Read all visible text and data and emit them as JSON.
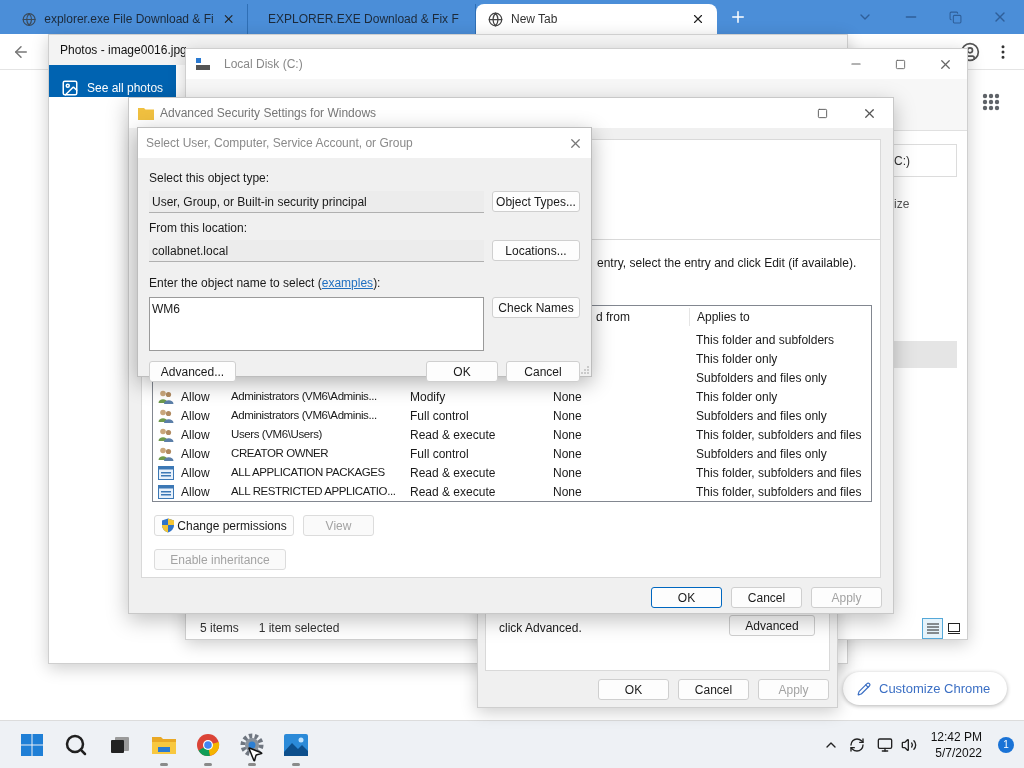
{
  "browser": {
    "tabs": [
      {
        "title": "explorer.exe File Download & Fi",
        "selected": false
      },
      {
        "title": "EXPLORER.EXE Download & Fix F",
        "selected": false
      },
      {
        "title": "New Tab",
        "selected": true
      }
    ],
    "customize": "Customize Chrome"
  },
  "photos": {
    "title": "Photos - image0016.jpg",
    "see_all": "See all photos"
  },
  "explorer": {
    "title": "Local Disk (C:)",
    "address": "C:)",
    "column_header": "ize",
    "item_count": "5 items",
    "selection": "1 item selected",
    "views": [
      {
        "kind": "details",
        "selected": true
      },
      {
        "kind": "thumbnails",
        "selected": false
      }
    ]
  },
  "properties": {
    "text": "click Advanced.",
    "advanced": "Advanced",
    "buttons": [
      {
        "label": "OK",
        "default": false,
        "disabled": false
      },
      {
        "label": "Cancel",
        "default": false,
        "disabled": false
      },
      {
        "label": "Apply",
        "default": false,
        "disabled": true
      }
    ]
  },
  "security": {
    "title": "Advanced Security Settings for Windows",
    "hint": "entry, select the entry and click Edit (if available).",
    "columns": [
      "d from",
      "Applies to"
    ],
    "rows": [
      {
        "applies": "This folder and subfolders"
      },
      {
        "applies": "This folder only"
      },
      {
        "applies": "Subfolders and files only"
      },
      {
        "kind": "group",
        "type": "Allow",
        "principal": "Administrators (VM6\\Adminis...",
        "access": "Modify",
        "inherited": "None",
        "applies": "This folder only"
      },
      {
        "kind": "group",
        "type": "Allow",
        "principal": "Administrators (VM6\\Adminis...",
        "access": "Full control",
        "inherited": "None",
        "applies": "Subfolders and files only"
      },
      {
        "kind": "group",
        "type": "Allow",
        "principal": "Users (VM6\\Users)",
        "access": "Read & execute",
        "inherited": "None",
        "applies": "This folder, subfolders and files"
      },
      {
        "kind": "group",
        "type": "Allow",
        "principal": "CREATOR OWNER",
        "access": "Full control",
        "inherited": "None",
        "applies": "Subfolders and files only"
      },
      {
        "kind": "package",
        "type": "Allow",
        "principal": "ALL APPLICATION PACKAGES",
        "access": "Read & execute",
        "inherited": "None",
        "applies": "This folder, subfolders and files"
      },
      {
        "kind": "package",
        "type": "Allow",
        "principal": "ALL RESTRICTED APPLICATIO...",
        "access": "Read & execute",
        "inherited": "None",
        "applies": "This folder, subfolders and files"
      }
    ],
    "actions": [
      {
        "label": "Change permissions",
        "disabled": false,
        "shield": true
      },
      {
        "label": "View",
        "disabled": true,
        "shield": false
      },
      {
        "label": "Enable inheritance",
        "disabled": true,
        "shield": false
      }
    ],
    "buttons": [
      {
        "label": "OK",
        "default": true,
        "disabled": false
      },
      {
        "label": "Cancel",
        "default": false,
        "disabled": false
      },
      {
        "label": "Apply",
        "default": false,
        "disabled": true
      }
    ]
  },
  "select_dialog": {
    "title": "Select User, Computer, Service Account, or Group",
    "type_label": "Select this object type:",
    "type_value": "User, Group, or Built-in security principal",
    "type_button": "Object Types...",
    "location_label": "From this location:",
    "location_value": "collabnet.local",
    "location_button": "Locations...",
    "name_label": {
      "before": "Enter the object name to select (",
      "link": "examples",
      "after": "):"
    },
    "name_value": "WM6",
    "check_button": "Check Names",
    "advanced_button": "Advanced...",
    "buttons": [
      {
        "label": "OK",
        "default": false,
        "disabled": false
      },
      {
        "label": "Cancel",
        "default": false,
        "disabled": false
      }
    ]
  },
  "taskbar": {
    "apps": [
      {
        "kind": "start",
        "running": false
      },
      {
        "kind": "search",
        "running": false
      },
      {
        "kind": "taskview",
        "running": false
      },
      {
        "kind": "explorer",
        "running": true
      },
      {
        "kind": "chrome",
        "running": true
      },
      {
        "kind": "settings",
        "running": true
      },
      {
        "kind": "photos",
        "running": true
      }
    ],
    "time": "12:42 PM",
    "date": "5/7/2022",
    "notifications": "1"
  }
}
